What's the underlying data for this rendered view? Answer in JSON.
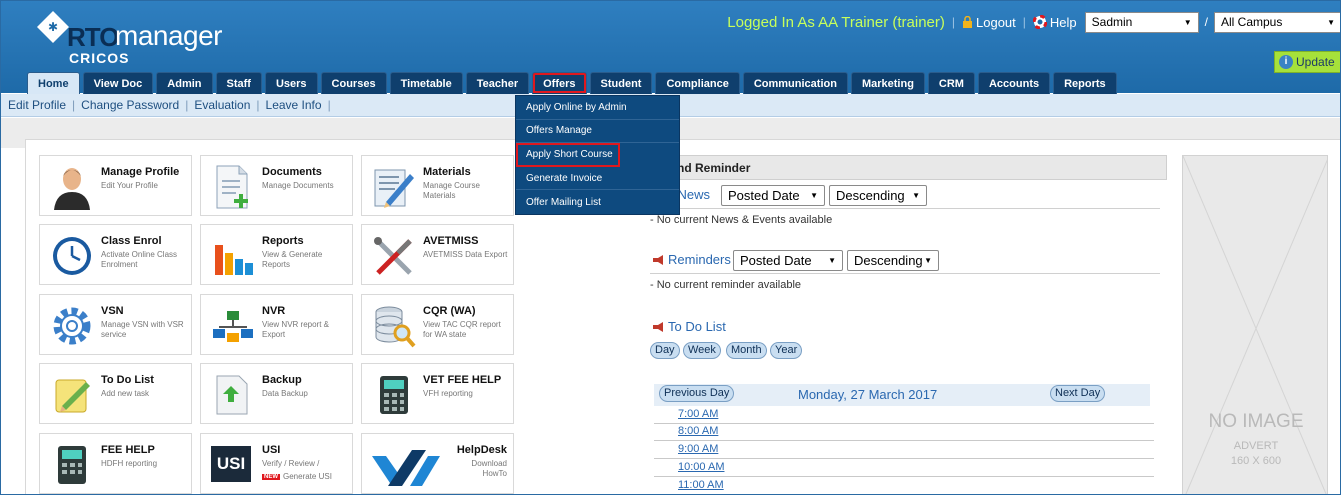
{
  "header": {
    "logo_rto": "RTO",
    "logo_manager": "manager",
    "logo_cricos": "CRICOS",
    "logged_in": "Logged In As  AA Trainer (trainer)",
    "logout": "Logout",
    "help": "Help",
    "user_select": "Sadmin",
    "slash": "/",
    "campus_select": "All Campus",
    "update_button": "Update"
  },
  "tabs": [
    "Home",
    "View Doc",
    "Admin",
    "Staff",
    "Users",
    "Courses",
    "Timetable",
    "Teacher",
    "Offers",
    "Student",
    "Compliance",
    "Communication",
    "Marketing",
    "CRM",
    "Accounts",
    "Reports"
  ],
  "subnav": [
    "Edit Profile",
    "Change Password",
    "Evaluation",
    "Leave Info"
  ],
  "offers_menu": [
    "Apply Online by Admin",
    "Offers Manage",
    "Apply Short Course",
    "Generate Invoice",
    "Offer Mailing List"
  ],
  "tiles": [
    {
      "title": "Manage Profile",
      "sub": "Edit Your Profile"
    },
    {
      "title": "Documents",
      "sub": "Manage Documents"
    },
    {
      "title": "Materials",
      "sub": "Manage Course Materials"
    },
    {
      "title": "Class Enrol",
      "sub": "Activate Online Class Enrolment"
    },
    {
      "title": "Reports",
      "sub": "View & Generate Reports"
    },
    {
      "title": "AVETMISS",
      "sub": "AVETMISS Data Export"
    },
    {
      "title": "VSN",
      "sub": "Manage VSN with VSR service"
    },
    {
      "title": "NVR",
      "sub": "View NVR report & Export"
    },
    {
      "title": "CQR (WA)",
      "sub": "View TAC CQR report for WA state"
    },
    {
      "title": "To Do List",
      "sub": "Add new task"
    },
    {
      "title": "Backup",
      "sub": "Data Backup"
    },
    {
      "title": "VET FEE HELP",
      "sub": "VFH reporting"
    },
    {
      "title": "FEE HELP",
      "sub": "HDFH reporting"
    },
    {
      "title": "USI",
      "sub": "Verify / Review /"
    },
    {
      "title": "HelpDesk",
      "sub": "Download HowTo"
    }
  ],
  "usi": {
    "logo": "USI",
    "new_badge": "NEW",
    "generate": "Generate USI"
  },
  "news": {
    "heading": "ws and Reminder",
    "latest_label": "itest News",
    "latest_sort": "Posted Date",
    "latest_order": "Descending",
    "no_news": "- No current News & Events available",
    "reminders_label": "Reminders",
    "reminders_sort": "Posted Date",
    "reminders_order": "Descending",
    "no_reminders": "- No current reminder available",
    "todo_label": "To Do List",
    "views": [
      "Day",
      "Week",
      "Month",
      "Year"
    ],
    "prev_day": "Previous Day",
    "date": "Monday, 27 March 2017",
    "next_day": "Next Day",
    "times": [
      "7:00 AM",
      "8:00 AM",
      "9:00 AM",
      "10:00 AM",
      "11:00 AM"
    ]
  },
  "advert": {
    "no_image": "NO IMAGE",
    "advert": "ADVERT",
    "size": "160 X 600"
  },
  "colors": {
    "header_blue": "#1e6aa8",
    "nav_dark": "#0f3f6d",
    "highlight_red": "#e0181e",
    "logged_green": "#c8ff5a"
  }
}
